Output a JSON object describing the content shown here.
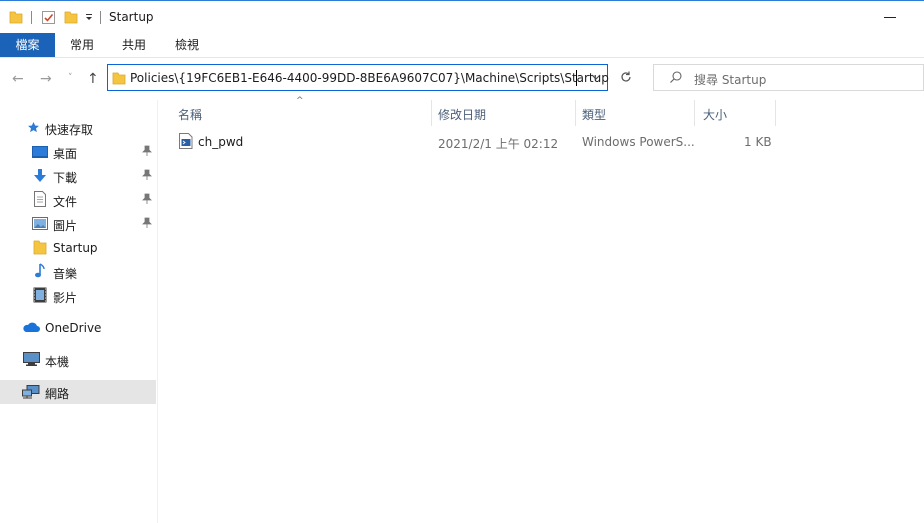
{
  "window": {
    "title": "Startup"
  },
  "ribbon": {
    "tabs": [
      "檔案",
      "常用",
      "共用",
      "檢視"
    ]
  },
  "address": {
    "path": "Policies\\{19FC6EB1-E646-4400-99DD-8BE6A9607C07}\\Machine\\Scripts\\Startup"
  },
  "search": {
    "placeholder": "搜尋 Startup"
  },
  "sidebar": {
    "quick_access": "快速存取",
    "items": [
      {
        "label": "桌面",
        "icon": "desktop-icon",
        "pinned": true
      },
      {
        "label": "下載",
        "icon": "download-icon",
        "pinned": true
      },
      {
        "label": "文件",
        "icon": "documents-icon",
        "pinned": true
      },
      {
        "label": "圖片",
        "icon": "pictures-icon",
        "pinned": true
      },
      {
        "label": "Startup",
        "icon": "folder-icon",
        "pinned": false
      },
      {
        "label": "音樂",
        "icon": "music-icon",
        "pinned": false
      },
      {
        "label": "影片",
        "icon": "videos-icon",
        "pinned": false
      }
    ],
    "onedrive": "OneDrive",
    "this_pc": "本機",
    "network": "網路"
  },
  "columns": {
    "name": "名稱",
    "modified": "修改日期",
    "type": "類型",
    "size": "大小"
  },
  "files": [
    {
      "name": "ch_pwd",
      "modified": "2021/2/1 上午 02:12",
      "type": "Windows PowerS...",
      "size": "1 KB"
    }
  ],
  "colors": {
    "accent": "#1a63b8",
    "folder": "#f5c542"
  }
}
